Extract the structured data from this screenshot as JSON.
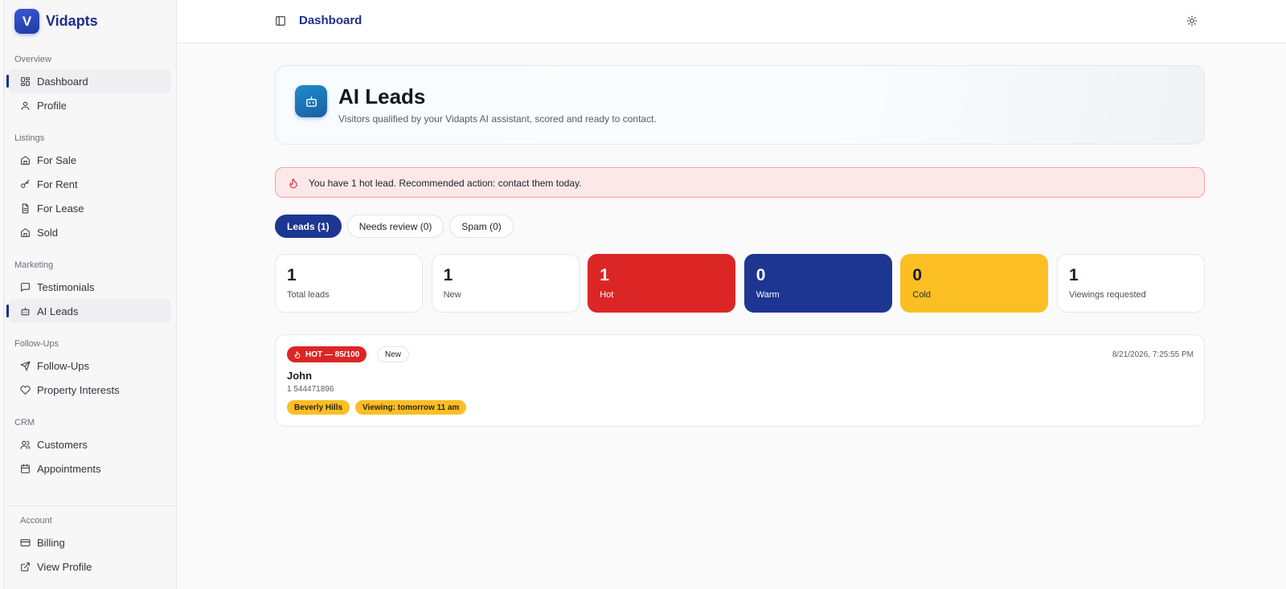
{
  "brand": {
    "logo_letter": "V",
    "name": "Vidapts"
  },
  "sidebar": {
    "groups": [
      {
        "heading": "Overview",
        "items": [
          {
            "label": "Dashboard",
            "icon": "grid-icon",
            "active": true
          },
          {
            "label": "Profile",
            "icon": "user-icon"
          }
        ]
      },
      {
        "heading": "Listings",
        "items": [
          {
            "label": "For Sale",
            "icon": "home-icon"
          },
          {
            "label": "For Rent",
            "icon": "key-icon"
          },
          {
            "label": "For Lease",
            "icon": "document-icon"
          },
          {
            "label": "Sold",
            "icon": "home-icon"
          }
        ]
      },
      {
        "heading": "Marketing",
        "items": [
          {
            "label": "Testimonials",
            "icon": "message-icon"
          },
          {
            "label": "AI Leads",
            "icon": "bot-icon",
            "active": true
          }
        ]
      },
      {
        "heading": "Follow-Ups",
        "items": [
          {
            "label": "Follow-Ups",
            "icon": "send-icon"
          },
          {
            "label": "Property Interests",
            "icon": "heart-icon"
          }
        ]
      },
      {
        "heading": "CRM",
        "items": [
          {
            "label": "Customers",
            "icon": "users-icon"
          },
          {
            "label": "Appointments",
            "icon": "calendar-icon"
          }
        ]
      }
    ],
    "account": {
      "heading": "Account",
      "items": [
        {
          "label": "Billing",
          "icon": "credit-card-icon"
        },
        {
          "label": "View Profile",
          "icon": "external-link-icon"
        }
      ]
    }
  },
  "topbar": {
    "title": "Dashboard",
    "toggle_icon": "sidebar-toggle-icon",
    "theme_icon": "sun-icon"
  },
  "hero": {
    "icon": "bot-icon",
    "title": "AI Leads",
    "subtitle": "Visitors qualified by your Vidapts AI assistant, scored and ready to contact."
  },
  "alert": {
    "icon": "flame-icon",
    "text": "You have 1 hot lead. Recommended action: contact them today."
  },
  "tabs": [
    {
      "label": "Leads (1)",
      "active": true
    },
    {
      "label": "Needs review (0)"
    },
    {
      "label": "Spam (0)"
    }
  ],
  "stats": [
    {
      "value": "1",
      "label": "Total leads",
      "variant": "default"
    },
    {
      "value": "1",
      "label": "New",
      "variant": "default"
    },
    {
      "value": "1",
      "label": "Hot",
      "variant": "hot"
    },
    {
      "value": "0",
      "label": "Warm",
      "variant": "warm"
    },
    {
      "value": "0",
      "label": "Cold",
      "variant": "cold"
    },
    {
      "value": "1",
      "label": "Viewings requested",
      "variant": "default"
    }
  ],
  "leads": [
    {
      "score_badge": "HOT — 85/100",
      "status_badge": "New",
      "timestamp": "8/21/2026, 7:25:55 PM",
      "name": "John",
      "phone": "1 544471896",
      "tags": [
        "Beverly Hills",
        "Viewing: tomorrow 11 am"
      ]
    }
  ],
  "colors": {
    "brand": "#1d2e8c",
    "hot": "#dc2626",
    "warm": "#1d3691",
    "cold": "#fbbf24",
    "alert_bg": "#fce8e9"
  }
}
